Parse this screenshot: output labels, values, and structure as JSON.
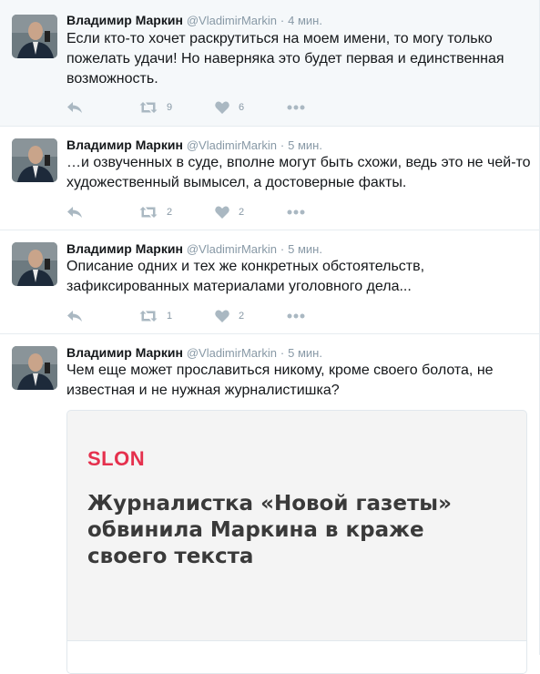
{
  "tweets": [
    {
      "name": "Владимир Маркин",
      "handle": "@VladimirMarkin",
      "time": "4 мин.",
      "text": "Если кто-то хочет раскрутиться на моем имени, то могу только пожелать удачи! Но наверняка это будет первая и единственная возможность.",
      "retweets": "9",
      "likes": "6"
    },
    {
      "name": "Владимир Маркин",
      "handle": "@VladimirMarkin",
      "time": "5 мин.",
      "text": "…и озвученных в суде, вполне могут быть схожи, ведь это не чей-то художественный вымысел, а достоверные факты.",
      "retweets": "2",
      "likes": "2"
    },
    {
      "name": "Владимир Маркин",
      "handle": "@VladimirMarkin",
      "time": "5 мин.",
      "text": "Описание одних и тех же конкретных обстоятельств, зафиксированных материалами уголовного дела...",
      "retweets": "1",
      "likes": "2"
    },
    {
      "name": "Владимир Маркин",
      "handle": "@VladimirMarkin",
      "time": "5 мин.",
      "text": "Чем еще может прославиться никому, кроме своего болота, не известная и не нужная журналистишка?"
    }
  ],
  "card": {
    "logo": "SLON",
    "title": "Журналистка «Новой газеты» обвинила Маркина в краже своего текста"
  },
  "separator": "·",
  "colors": {
    "name": "#14171a",
    "meta": "#8899a6",
    "icon": "#aab8c2",
    "logo": "#e5304d",
    "highlight_bg": "#f5f8fa"
  },
  "icons": [
    "reply-icon",
    "retweet-icon",
    "heart-icon",
    "more-icon"
  ]
}
